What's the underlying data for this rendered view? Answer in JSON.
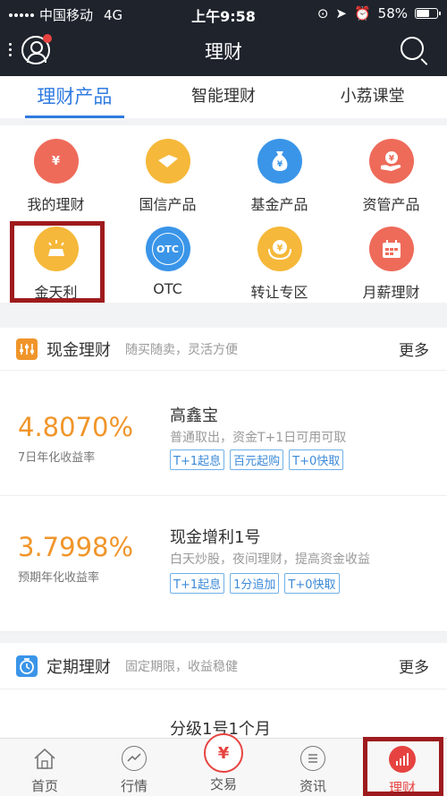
{
  "status_bar": {
    "carrier": "中国移动",
    "network": "4G",
    "time": "上午9:58",
    "battery": "58%"
  },
  "nav": {
    "title": "理财"
  },
  "tabs": [
    {
      "label": "理财产品",
      "active": true
    },
    {
      "label": "智能理财",
      "active": false
    },
    {
      "label": "小荔课堂",
      "active": false
    }
  ],
  "grid": [
    {
      "label": "我的理财",
      "icon": "my-finance-icon",
      "color": "#ee6b5a",
      "glyph": "¥"
    },
    {
      "label": "国信产品",
      "icon": "guoxin-product-icon",
      "color": "#f5b83a",
      "glyph": ""
    },
    {
      "label": "基金产品",
      "icon": "fund-product-icon",
      "color": "#3a95e8",
      "glyph": "¥"
    },
    {
      "label": "资管产品",
      "icon": "asset-management-icon",
      "color": "#ee6b5a",
      "glyph": "¥"
    },
    {
      "label": "金天利",
      "icon": "gold-bar-icon",
      "color": "#f5b83a",
      "glyph": ""
    },
    {
      "label": "OTC",
      "icon": "otc-icon",
      "color": "#3a95e8",
      "glyph": "OTC"
    },
    {
      "label": "转让专区",
      "icon": "transfer-zone-icon",
      "color": "#f5b83a",
      "glyph": "¥"
    },
    {
      "label": "月薪理财",
      "icon": "monthly-salary-icon",
      "color": "#ee6b5a",
      "glyph": ""
    }
  ],
  "cash_section": {
    "title": "现金理财",
    "subtitle": "随买随卖，灵活方便",
    "more": "更多",
    "icon": "cash-chart-icon",
    "products": [
      {
        "rate": "4.8070%",
        "rate_label": "7日年化收益率",
        "name": "高鑫宝",
        "desc": "普通取出，资金T+1日可用可取",
        "tags": [
          "T+1起息",
          "百元起购",
          "T+0快取"
        ]
      },
      {
        "rate": "3.7998%",
        "rate_label": "预期年化收益率",
        "name": "现金增利1号",
        "desc": "白天炒股，夜间理财，提高资金收益",
        "tags": [
          "T+1起息",
          "1分追加",
          "T+0快取"
        ]
      }
    ]
  },
  "fixed_section": {
    "title": "定期理财",
    "subtitle": "固定期限，收益稳健",
    "more": "更多",
    "icon": "clock-icon",
    "product_name": "分级1号1个月"
  },
  "bottom_nav": [
    {
      "label": "首页",
      "icon": "home-icon",
      "active": false
    },
    {
      "label": "行情",
      "icon": "market-icon",
      "active": false
    },
    {
      "label": "交易",
      "icon": "trade-icon",
      "active": false
    },
    {
      "label": "资讯",
      "icon": "news-icon",
      "active": false
    },
    {
      "label": "理财",
      "icon": "finance-icon",
      "active": true
    }
  ],
  "colors": {
    "accent": "#2f7be0",
    "rate": "#f0952a",
    "highlight_box": "#9e1b1d",
    "navbar": "#1e232c"
  }
}
